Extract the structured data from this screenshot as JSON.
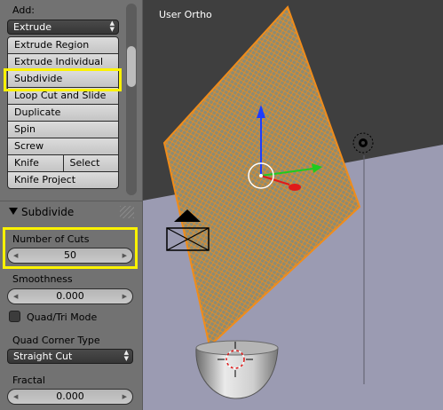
{
  "shelf": {
    "add_label": "Add:",
    "add_dropdown": "Extrude",
    "buttons": {
      "extrude_region": "Extrude Region",
      "extrude_individual": "Extrude Individual",
      "subdivide": "Subdivide",
      "loop_cut_and_slide": "Loop Cut and Slide",
      "duplicate": "Duplicate",
      "spin": "Spin",
      "screw": "Screw",
      "knife": "Knife",
      "select": "Select",
      "knife_project": "Knife Project"
    }
  },
  "operator": {
    "title": "Subdivide",
    "number_of_cuts_label": "Number of Cuts",
    "number_of_cuts": "50",
    "smoothness_label": "Smoothness",
    "smoothness": "0.000",
    "quad_tri_label": "Quad/Tri Mode",
    "quad_tri_checked": false,
    "quad_corner_label": "Quad Corner Type",
    "quad_corner_value": "Straight Cut",
    "fractal_label": "Fractal",
    "fractal": "0.000"
  },
  "viewport": {
    "title": "User Ortho"
  },
  "colors": {
    "highlight": "#fbf200",
    "mesh_wire": "#f08c1a",
    "mesh_face": "#8c8c74",
    "floor": "#9b9bb2",
    "background": "#3f3f3f"
  }
}
